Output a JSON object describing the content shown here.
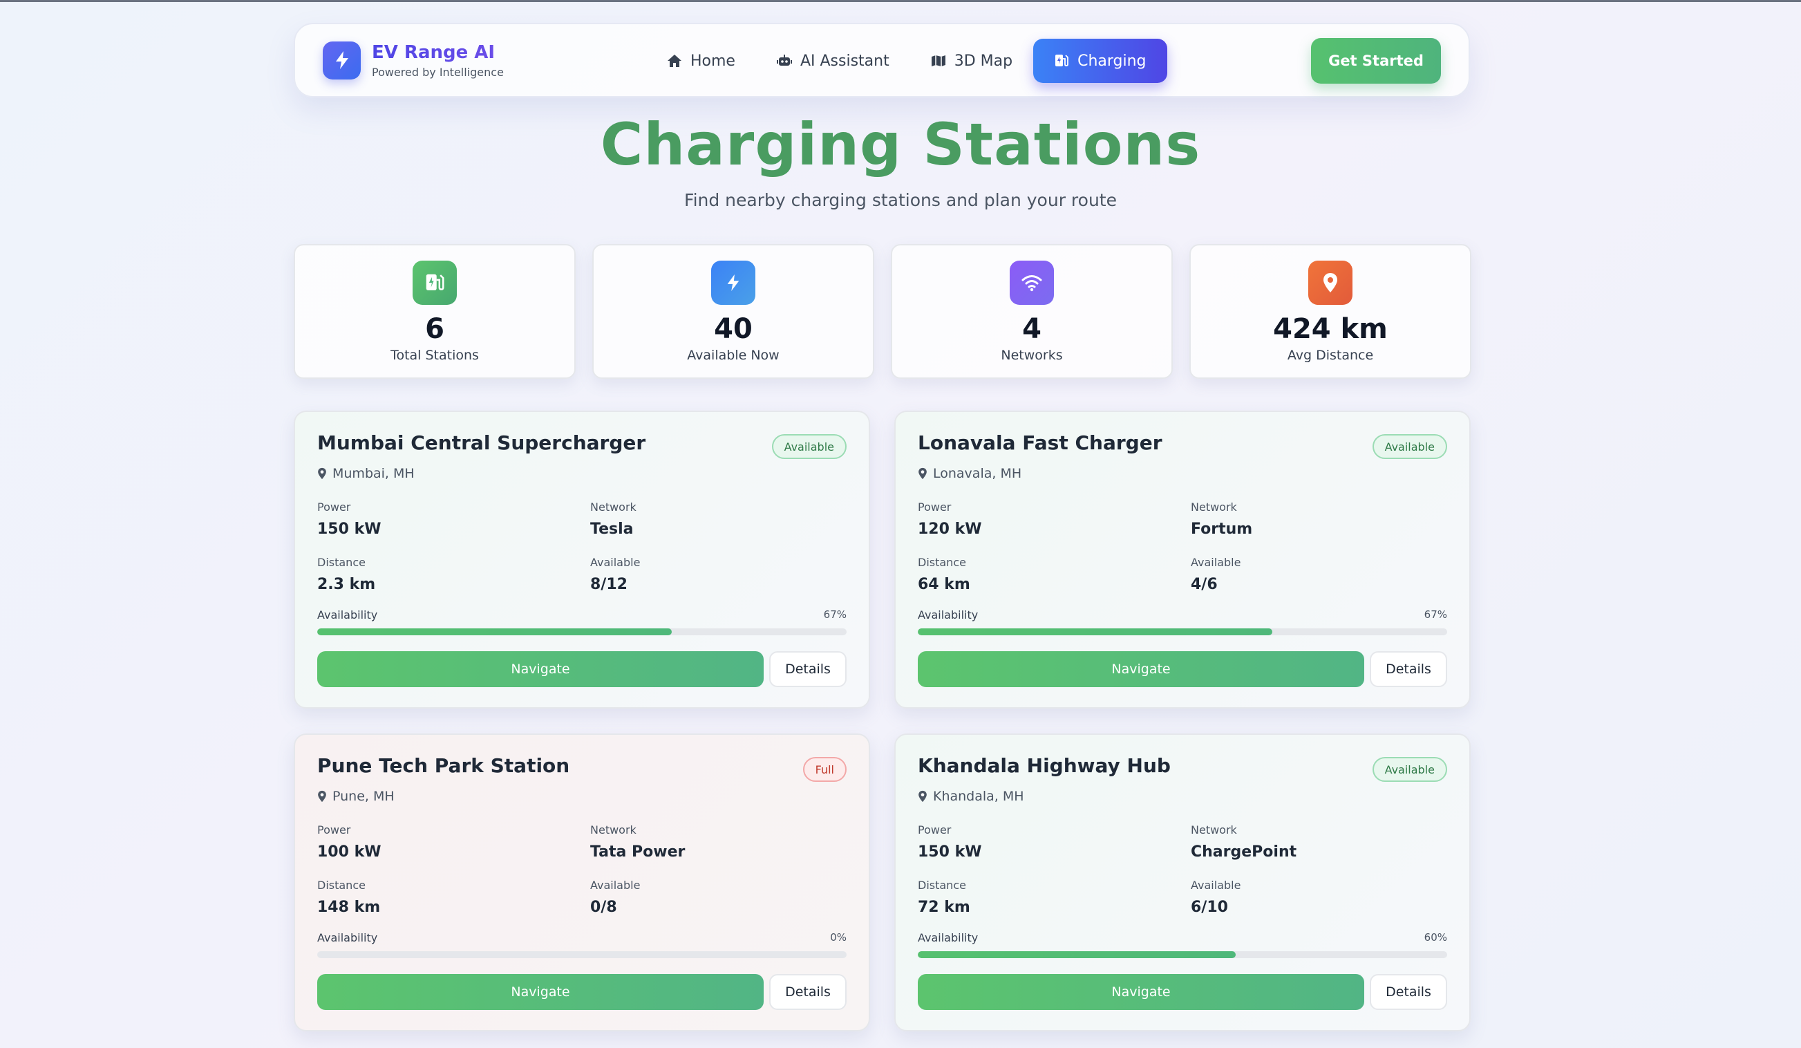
{
  "brand": {
    "name": "EV Range AI",
    "tagline": "Powered by Intelligence"
  },
  "nav": {
    "items": [
      {
        "label": "Home",
        "icon": "home-icon",
        "active": false
      },
      {
        "label": "AI Assistant",
        "icon": "robot-icon",
        "active": false
      },
      {
        "label": "3D Map",
        "icon": "map-icon",
        "active": false
      },
      {
        "label": "Charging",
        "icon": "charging-station-icon",
        "active": true
      }
    ],
    "cta_label": "Get Started"
  },
  "page": {
    "title": "Charging Stations",
    "subtitle": "Find nearby charging stations and plan your route"
  },
  "stats": [
    {
      "value": "6",
      "label": "Total Stations",
      "icon": "charging-station-icon",
      "color": "#4fb87a"
    },
    {
      "value": "40",
      "label": "Available Now",
      "icon": "lightning-icon",
      "color": "#3b82f6"
    },
    {
      "value": "4",
      "label": "Networks",
      "icon": "wifi-icon",
      "color": "#8b5cf6"
    },
    {
      "value": "424 km",
      "label": "Avg Distance",
      "icon": "location-pin-icon",
      "color": "#ea6a3a"
    }
  ],
  "labels": {
    "power": "Power",
    "network": "Network",
    "distance": "Distance",
    "available": "Available",
    "availability": "Availability",
    "navigate": "Navigate",
    "details": "Details"
  },
  "stations": [
    {
      "name": "Mumbai Central Supercharger",
      "location": "Mumbai, MH",
      "status": "Available",
      "status_type": "ok",
      "power": "150 kW",
      "network": "Tesla",
      "distance": "2.3 km",
      "available": "8/12",
      "availability_pct": "67%",
      "fill": 0.67
    },
    {
      "name": "Lonavala Fast Charger",
      "location": "Lonavala, MH",
      "status": "Available",
      "status_type": "ok",
      "power": "120 kW",
      "network": "Fortum",
      "distance": "64 km",
      "available": "4/6",
      "availability_pct": "67%",
      "fill": 0.67
    },
    {
      "name": "Pune Tech Park Station",
      "location": "Pune, MH",
      "status": "Full",
      "status_type": "full",
      "power": "100 kW",
      "network": "Tata Power",
      "distance": "148 km",
      "available": "0/8",
      "availability_pct": "0%",
      "fill": 0
    },
    {
      "name": "Khandala Highway Hub",
      "location": "Khandala, MH",
      "status": "Available",
      "status_type": "ok",
      "power": "150 kW",
      "network": "ChargePoint",
      "distance": "72 km",
      "available": "6/10",
      "availability_pct": "60%",
      "fill": 0.6
    }
  ]
}
